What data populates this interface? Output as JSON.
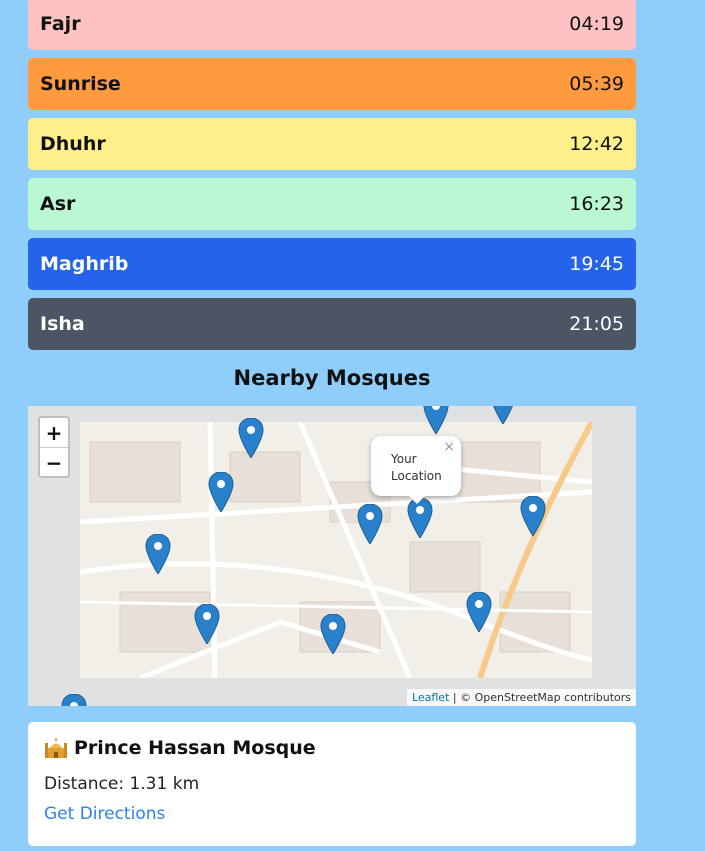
{
  "prayers": [
    {
      "name": "Fajr",
      "time": "04:19",
      "color": "#ffc2c2"
    },
    {
      "name": "Sunrise",
      "time": "05:39",
      "color": "#ff9a3e"
    },
    {
      "name": "Dhuhr",
      "time": "12:42",
      "color": "#fdf08a"
    },
    {
      "name": "Asr",
      "time": "16:23",
      "color": "#b9f8d3"
    },
    {
      "name": "Maghrib",
      "time": "19:45",
      "color": "#2563eb"
    },
    {
      "name": "Isha",
      "time": "21:05",
      "color": "#4b5563"
    }
  ],
  "section": {
    "title": "Nearby Mosques"
  },
  "map": {
    "zoom_in": "+",
    "zoom_out": "−",
    "popup_text": "Your Location",
    "popup_close": "×",
    "attribution_link": "Leaflet",
    "attribution_text": "| © OpenStreetMap contributors",
    "marker_color": "#2a81cb"
  },
  "mosque": {
    "icon": "mosque-icon",
    "name": "Prince Hassan Mosque",
    "distance": "Distance: 1.31 km",
    "directions": "Get Directions"
  }
}
